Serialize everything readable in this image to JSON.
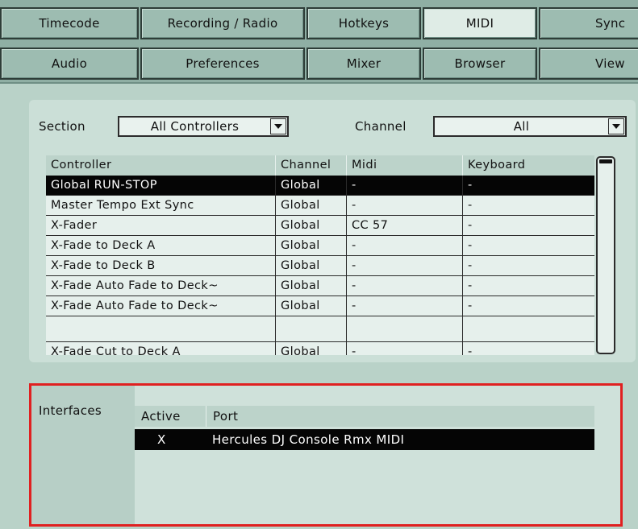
{
  "tabs": {
    "row1": [
      "Timecode",
      "Recording / Radio",
      "Hotkeys",
      "MIDI",
      "Sync"
    ],
    "row2": [
      "Audio",
      "Preferences",
      "Mixer",
      "Browser",
      "View"
    ],
    "active": "MIDI"
  },
  "filters": {
    "section_label": "Section",
    "section_value": "All Controllers",
    "channel_label": "Channel",
    "channel_value": "All"
  },
  "controllers": {
    "headers": [
      "Controller",
      "Channel",
      "Midi",
      "Keyboard"
    ],
    "rows": [
      [
        "Global RUN-STOP",
        "Global",
        "-",
        "-"
      ],
      [
        "Master Tempo Ext Sync",
        "Global",
        "-",
        "-"
      ],
      [
        "X-Fader",
        "Global",
        "CC 57",
        "-"
      ],
      [
        "X-Fade to Deck A",
        "Global",
        "-",
        "-"
      ],
      [
        "X-Fade to Deck B",
        "Global",
        "-",
        "-"
      ],
      [
        "X-Fade Auto Fade to Deck~",
        "Global",
        "-",
        "-"
      ],
      [
        "X-Fade Auto Fade to Deck~",
        "Global",
        "-",
        "-"
      ],
      [
        "X-Fade Cut to Deck A",
        "Global",
        "-",
        "-"
      ]
    ],
    "selected_index": 0
  },
  "interfaces": {
    "label": "Interfaces",
    "headers": [
      "Active",
      "Port"
    ],
    "rows": [
      [
        "X",
        "Hercules DJ Console Rmx MIDI"
      ]
    ]
  },
  "colors": {
    "highlight": "#e02020",
    "selected_row": "#050505"
  }
}
